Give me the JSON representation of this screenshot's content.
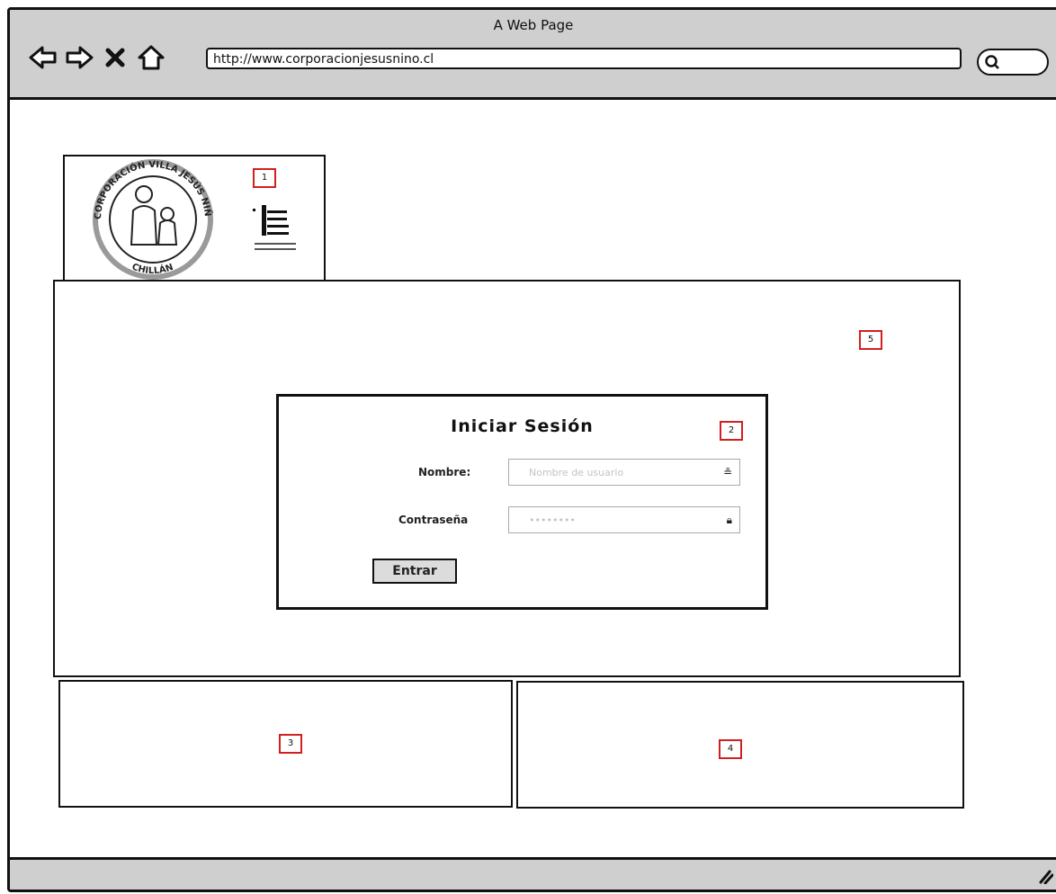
{
  "window": {
    "title": "A Web Page"
  },
  "toolbar": {
    "url": "http://www.corporacionjesusnino.cl",
    "nav_icons": [
      "back-icon",
      "forward-icon",
      "close-icon",
      "home-icon"
    ]
  },
  "logo": {
    "seal_text": "CORPORACIÓN VILLA JESÚS NIÑO",
    "seal_bottom": "CHILLÁN"
  },
  "markers": {
    "m1": "1",
    "m2": "2",
    "m3": "3",
    "m4": "4",
    "m5": "5"
  },
  "login": {
    "title": "Iniciar Sesión",
    "name_label": "Nombre:",
    "name_placeholder": "Nombre de usuario",
    "password_label": "Contraseña",
    "password_placeholder": "••••••••",
    "submit_label": "Entrar"
  },
  "colors": {
    "chrome": "#cfcfcf",
    "marker": "#d21f1f",
    "stroke": "#111111"
  }
}
